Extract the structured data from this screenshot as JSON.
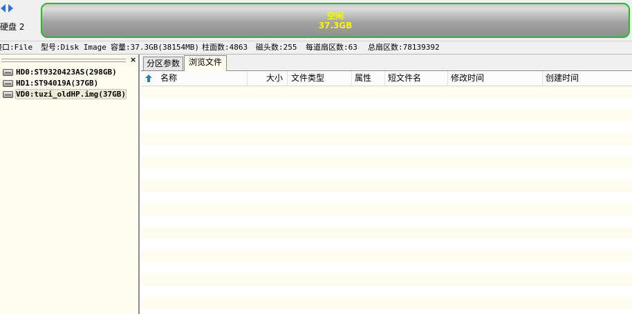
{
  "top": {
    "disk_label": "硬盘 2",
    "partition_bar": {
      "title": "空闲",
      "size": "37.3GB",
      "text_color": "#f8f800",
      "border_color": "#1fbf1f"
    }
  },
  "info": {
    "interface": "接口:File",
    "model": "型号:Disk Image",
    "capacity": "容量:37.3GB(38154MB)",
    "cylinders": "柱面数:4863",
    "heads": "磁头数:255",
    "sectors_per_track": "每道扇区数:63",
    "total_sectors": "总扇区数:78139392"
  },
  "tree": {
    "close_glyph": "×",
    "items": [
      {
        "label": "HD0:ST9320423AS(298GB)"
      },
      {
        "label": "HD1:ST94019A(37GB)"
      },
      {
        "label": "VD0:tuzi_oldHP.img(37GB)"
      }
    ]
  },
  "tabs": [
    {
      "label": "分区参数"
    },
    {
      "label": "浏览文件"
    }
  ],
  "columns": {
    "name": "名称",
    "size": "大小",
    "type": "文件类型",
    "attr": "属性",
    "short": "短文件名",
    "modified": "修改时间",
    "created": "创建时间"
  },
  "colors": {
    "accent_blue": "#2f6fd6",
    "panel_bg": "#fdfcee"
  }
}
